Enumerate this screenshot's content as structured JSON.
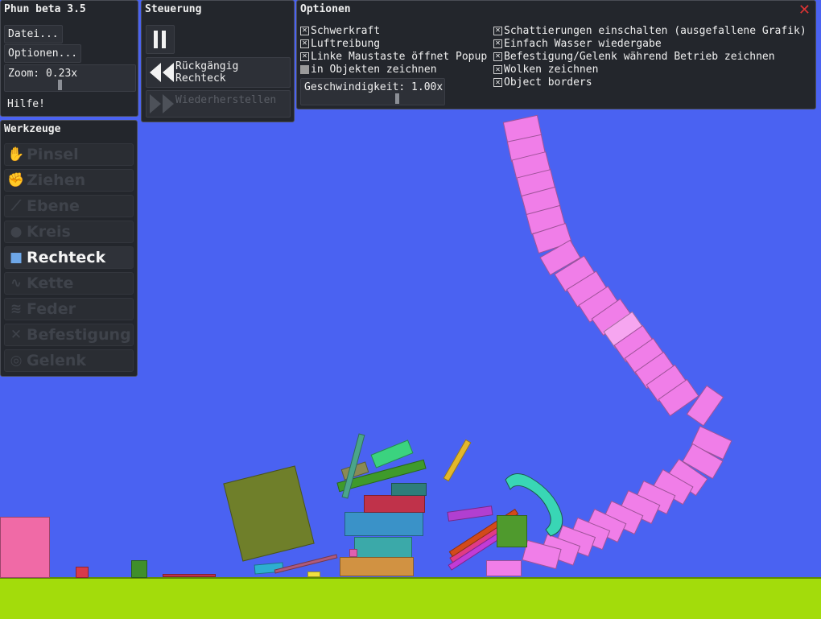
{
  "app": {
    "title": "Phun beta 3.5",
    "menu": {
      "file": "Datei...",
      "options": "Optionen...",
      "zoom": "Zoom: 0.23x",
      "help": "Hilfe!"
    }
  },
  "control": {
    "title": "Steuerung",
    "pause_icon": "pause-icon",
    "undo_label": "Rückgängig\nRechteck",
    "undo_line1": "Rückgängig",
    "undo_line2": "Rechteck",
    "redo_label": "Wiederherstellen"
  },
  "options": {
    "title": "Optionen",
    "close_icon": "close-icon",
    "left": [
      {
        "label": "Schwerkraft",
        "checked": true
      },
      {
        "label": "Luftreibung",
        "checked": true
      },
      {
        "label": "Linke Maustaste öffnet Popup",
        "checked": true
      },
      {
        "label": "in Objekten zeichnen",
        "checked": false
      }
    ],
    "right": [
      {
        "label": "Schattierungen einschalten (ausgefallene Grafik)",
        "checked": true
      },
      {
        "label": "Einfach Wasser wiedergabe",
        "checked": true
      },
      {
        "label": "Befestigung/Gelenk während Betrieb zeichnen",
        "checked": true
      },
      {
        "label": "Wolken zeichnen",
        "checked": true
      },
      {
        "label": "Object borders",
        "checked": true
      }
    ],
    "speed": "Geschwindigkeit: 1.00x"
  },
  "tools": {
    "title": "Werkzeuge",
    "items": [
      {
        "label": "Pinsel",
        "icon": "brush-icon",
        "active": false
      },
      {
        "label": "Ziehen",
        "icon": "drag-icon",
        "active": false
      },
      {
        "label": "Ebene",
        "icon": "plane-icon",
        "active": false
      },
      {
        "label": "Kreis",
        "icon": "circle-icon",
        "active": false
      },
      {
        "label": "Rechteck",
        "icon": "rectangle-icon",
        "active": true
      },
      {
        "label": "Kette",
        "icon": "chain-icon",
        "active": false
      },
      {
        "label": "Feder",
        "icon": "spring-icon",
        "active": false
      },
      {
        "label": "Befestigung",
        "icon": "fixate-icon",
        "active": false
      },
      {
        "label": "Gelenk",
        "icon": "hinge-icon",
        "active": false
      }
    ]
  },
  "colors": {
    "background": "#4a62f2",
    "ground": "#a3dc0b",
    "chain": "#f07ee8",
    "accent_tool": "#6ea7e8"
  }
}
